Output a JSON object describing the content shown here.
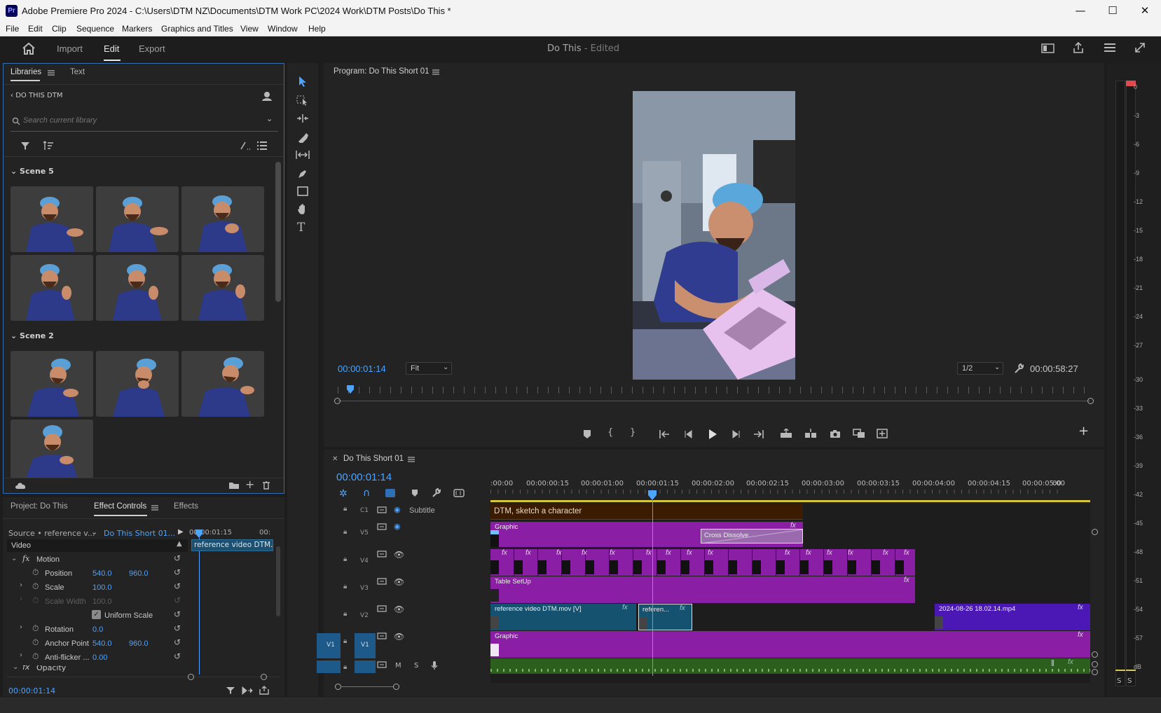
{
  "window": {
    "app_icon": "Pr",
    "title": "Adobe Premiere Pro 2024 - C:\\Users\\DTM NZ\\Documents\\DTM Work PC\\2024 Work\\DTM Posts\\Do This *",
    "minimize": "—",
    "maximize": "☐",
    "close": "✕"
  },
  "menu": [
    "File",
    "Edit",
    "Clip",
    "Sequence",
    "Markers",
    "Graphics and Titles",
    "View",
    "Window",
    "Help"
  ],
  "header": {
    "tabs": [
      "Import",
      "Edit",
      "Export"
    ],
    "active_tab": "Edit",
    "project_name": "Do This",
    "project_status": "- Edited"
  },
  "libraries": {
    "tab_libraries": "Libraries",
    "tab_text": "Text",
    "library_name": "DO THIS DTM",
    "search_placeholder": "Search current library",
    "group1": "Scene 5",
    "group2": "Scene 2"
  },
  "program_monitor": {
    "title": "Program: Do This Short 01",
    "timecode": "00:00:01:14",
    "zoom": "Fit",
    "resolution": "1/2",
    "duration": "00:00:58:27"
  },
  "effect_controls": {
    "tab_project": "Project: Do This",
    "tab_effect_controls": "Effect Controls",
    "tab_effects": "Effects",
    "source": "Source • reference v...",
    "sequence": "Do This Short 01...",
    "mini_timecode": "00:00:01:15",
    "mini_timecode_end": "00:",
    "clip_label": "reference video DTM.r",
    "section_video": "Video",
    "motion": "Motion",
    "position_label": "Position",
    "position_x": "540.0",
    "position_y": "960.0",
    "scale_label": "Scale",
    "scale_value": "100.0",
    "scale_width_label": "Scale Width",
    "scale_width_value": "100.0",
    "uniform_scale_label": "Uniform Scale",
    "rotation_label": "Rotation",
    "rotation_value": "0.0",
    "anchor_label": "Anchor Point",
    "anchor_x": "540.0",
    "anchor_y": "960.0",
    "antiflicker_label": "Anti-flicker ...",
    "antiflicker_value": "0.00",
    "opacity_label": "Opacity",
    "timecode": "00:00:01:14"
  },
  "timeline": {
    "sequence_name": "Do This Short 01",
    "timecode": "00:00:01:14",
    "ruler": [
      ":00:00",
      "00:00:00:15",
      "00:00:01:00",
      "00:00:01:15",
      "00:00:02:00",
      "00:00:02:15",
      "00:00:03:00",
      "00:00:03:15",
      "00:00:04:00",
      "00:00:04:15",
      "00:00:05:00",
      "00"
    ],
    "tracks": {
      "c1": "C1",
      "subtitle": "Subtitle",
      "v5": "V5",
      "v4": "V4",
      "v3": "V3",
      "v2": "V2",
      "v1": "V1",
      "v1_source": "V1",
      "audio_m": "M",
      "audio_s": "S"
    },
    "clips": {
      "subtitle": "DTM, sketch a character",
      "v5_graphic": "Graphic",
      "v5_transition": "Cross Dissolve",
      "v3_table": "Table SetUp",
      "v2_ref": "reference video DTM.mov [V]",
      "v2_ref2": "referen...",
      "v2_mp4": "2024-08-26 18.02.14.mp4",
      "v1_graphic": "Graphic"
    },
    "fx_label": "fx"
  },
  "meter": {
    "labels": [
      "0",
      "-3",
      "-6",
      "-9",
      "-12",
      "-15",
      "-18",
      "-21",
      "-24",
      "-27",
      "-30",
      "-33",
      "-36",
      "-39",
      "-42",
      "-45",
      "-48",
      "-51",
      "-54",
      "-57",
      "dB"
    ],
    "solo_left": "S",
    "solo_right": "S"
  },
  "colors": {
    "accent": "#4da3ff",
    "subtitle_clip": "#3b1c00",
    "graphic_clip": "#8a1fa6",
    "video_clip": "#145270",
    "mp4_clip": "#4b18b5",
    "audio_clip": "#2c5e1e"
  }
}
